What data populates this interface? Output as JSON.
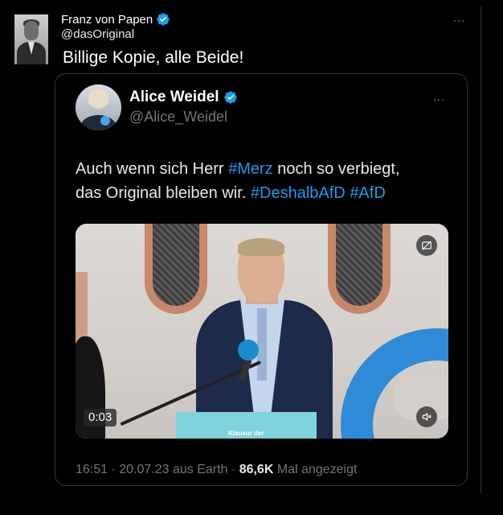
{
  "outer_tweet": {
    "author_name": "Franz von Papen",
    "handle": "@dasOriginal",
    "text": "Billige Kopie, alle Beide!",
    "more": "…"
  },
  "quoted_tweet": {
    "author_name": "Alice Weidel",
    "handle": "@Alice_Weidel",
    "more": "…",
    "text_parts": {
      "p1": "Auch wenn sich Herr ",
      "h1": "#Merz",
      "p2": " noch so verbiegt,",
      "p3": "das Original bleiben wir. ",
      "h2": "#DeshalbAfD",
      "sp": " ",
      "h3": "#AfD"
    },
    "media": {
      "duration": "0:03",
      "lectern_text": "Klausur der"
    },
    "meta": {
      "timestamp": "16:51 · 20.07.23 aus Earth · ",
      "views_count": "86,6K",
      "views_label": " Mal angezeigt"
    }
  },
  "colors": {
    "background": "#000000",
    "link": "#1d9bf0",
    "verified": "#1d9bf0",
    "muted": "#71767b"
  },
  "icons": [
    "verified-badge-icon",
    "more-icon",
    "mute-icon",
    "caption-off-icon"
  ]
}
